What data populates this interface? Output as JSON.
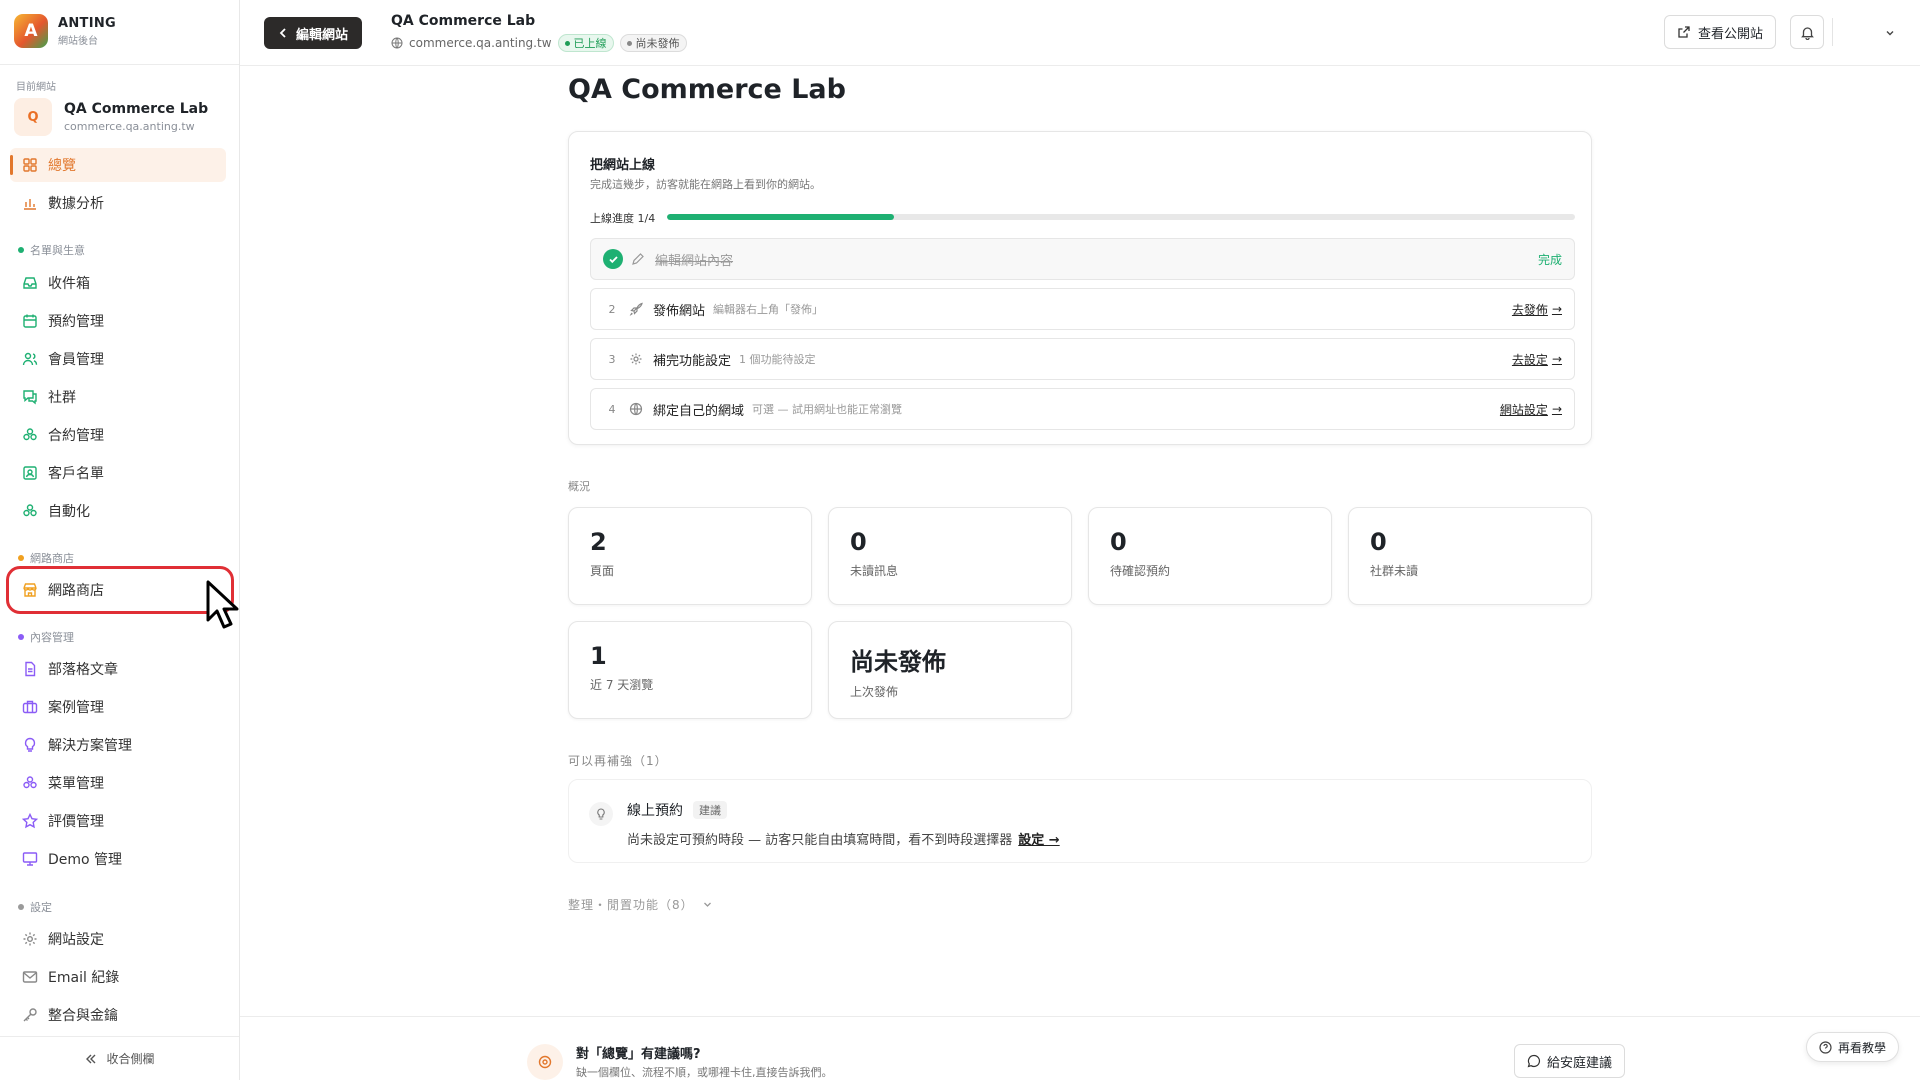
{
  "brand": {
    "name": "ANTING",
    "subtitle": "網站後台",
    "logo_letter": "A"
  },
  "current_site": {
    "label": "目前網站",
    "avatar_letter": "Q",
    "name": "QA Commerce Lab",
    "url": "commerce.qa.anting.tw"
  },
  "sidebar": {
    "top_items": [
      {
        "label": "總覽",
        "icon": "grid-icon",
        "active": true
      },
      {
        "label": "數據分析",
        "icon": "bar-chart-icon"
      }
    ],
    "sections": [
      {
        "label": "名單與生意",
        "dot_color": "#1eb072",
        "items": [
          "收件箱",
          "預約管理",
          "會員管理",
          "社群",
          "合約管理",
          "客戶名單",
          "自動化"
        ]
      },
      {
        "label": "網路商店",
        "dot_color": "#f0a020",
        "items": [
          "網路商店"
        ]
      },
      {
        "label": "內容管理",
        "dot_color": "#8b5cf6",
        "items": [
          "部落格文章",
          "案例管理",
          "解決方案管理",
          "菜單管理",
          "評價管理",
          "Demo 管理"
        ]
      },
      {
        "label": "設定",
        "dot_color": "#9a9a9a",
        "items": [
          "網站設定",
          "Email 紀錄",
          "整合與金鑰"
        ]
      }
    ],
    "collapse_label": "收合側欄"
  },
  "topbar": {
    "edit_button": "編輯網站",
    "site_title": "QA Commerce Lab",
    "site_domain": "commerce.qa.anting.tw",
    "status_live": "已上線",
    "status_draft": "尚未發佈",
    "view_public": "查看公開站"
  },
  "main": {
    "page_title": "QA Commerce Lab",
    "launch": {
      "title": "把網站上線",
      "subtitle": "完成這幾步，訪客就能在網路上看到你的網站。",
      "progress_label": "上線進度 1/4",
      "progress_fraction": 0.25,
      "steps": [
        {
          "num": "",
          "text": "編輯網站內容",
          "hint": "",
          "action": "",
          "done_label": "完成",
          "done": true
        },
        {
          "num": "2",
          "text": "發佈網站",
          "hint": "編輯器右上角「發佈」",
          "action": "去發佈"
        },
        {
          "num": "3",
          "text": "補完功能設定",
          "hint": "1 個功能待設定",
          "action": "去設定"
        },
        {
          "num": "4",
          "text": "綁定自己的網域",
          "hint": "可選 — 試用網址也能正常瀏覽",
          "action": "網站設定"
        }
      ]
    },
    "overview_label": "概況",
    "stats": [
      {
        "value": "2",
        "label": "頁面"
      },
      {
        "value": "0",
        "label": "未讀訊息"
      },
      {
        "value": "0",
        "label": "待確認預約"
      },
      {
        "value": "0",
        "label": "社群未讀"
      },
      {
        "value": "1",
        "label": "近 7 天瀏覽"
      },
      {
        "value": "尚未發佈",
        "label": "上次發佈"
      }
    ],
    "more_label": "可以再補強（1）",
    "suggestion": {
      "title": "線上預約",
      "tag": "建議",
      "desc": "尚未設定可預約時段 — 訪客只能自由填寫時間，看不到時段選擇器",
      "link": "設定 →"
    },
    "fold_label": "整理・閒置功能（8）"
  },
  "feedback": {
    "title": "對「總覽」有建議嗎?",
    "subtitle": "缺一個欄位、流程不順，或哪裡卡住,直接告訴我們。",
    "button": "給安庭建議"
  },
  "tutorial_button": "再看教學",
  "colors": {
    "accent": "#e2772c",
    "success": "#1eb072",
    "dark_button": "#2c2a29",
    "highlight": "#e02f35"
  }
}
